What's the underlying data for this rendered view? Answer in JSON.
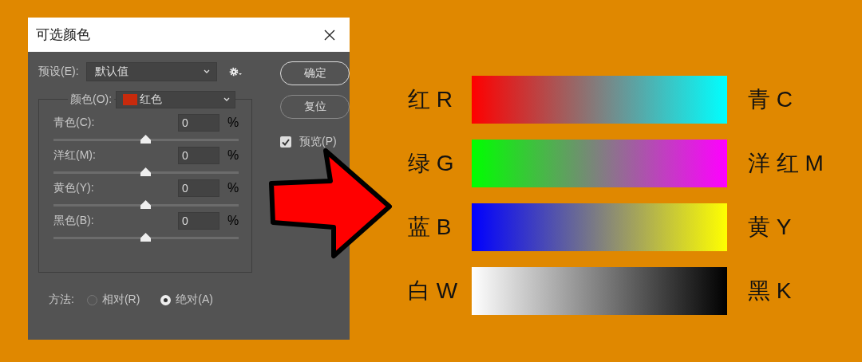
{
  "dialog": {
    "title": "可选颜色",
    "preset": {
      "label": "预设(E):",
      "value": "默认值"
    },
    "buttons": [
      {
        "label": "确定",
        "kind": "default"
      },
      {
        "label": "复位",
        "kind": "normal"
      }
    ],
    "preview": {
      "label": "预览(P)",
      "checked": true
    },
    "color": {
      "label": "颜色(O):",
      "value": "红色",
      "color": "#c82a0c"
    },
    "sliders": [
      {
        "label": "青色(C):",
        "value": "0",
        "unit": "%",
        "level": 0.5
      },
      {
        "label": "洋红(M):",
        "value": "0",
        "unit": "%",
        "level": 0.5
      },
      {
        "label": "黄色(Y):",
        "value": "0",
        "unit": "%",
        "level": 0.5
      },
      {
        "label": "黑色(B):",
        "value": "0",
        "unit": "%",
        "level": 0.5
      }
    ],
    "method": {
      "label": "方法:",
      "options": [
        {
          "label": "相对(R)",
          "selected": false
        },
        {
          "label": "绝对(A)",
          "selected": true
        }
      ]
    }
  },
  "gradients": [
    {
      "left_label": "红 R",
      "right_label": "青 C",
      "stops": [
        {
          "color": "#ff0000"
        },
        {
          "color": "#00ffff"
        }
      ]
    },
    {
      "left_label": "绿 G",
      "right_label": "洋 红 M",
      "stops": [
        {
          "color": "#00ff00"
        },
        {
          "color": "#ff00ff"
        }
      ]
    },
    {
      "left_label": "蓝 B",
      "right_label": "黄 Y",
      "stops": [
        {
          "color": "#0000ff"
        },
        {
          "color": "#ffff00"
        }
      ]
    },
    {
      "left_label": "白 W",
      "right_label": "黑 K",
      "stops": [
        {
          "color": "#ffffff"
        },
        {
          "color": "#000000"
        }
      ]
    }
  ]
}
